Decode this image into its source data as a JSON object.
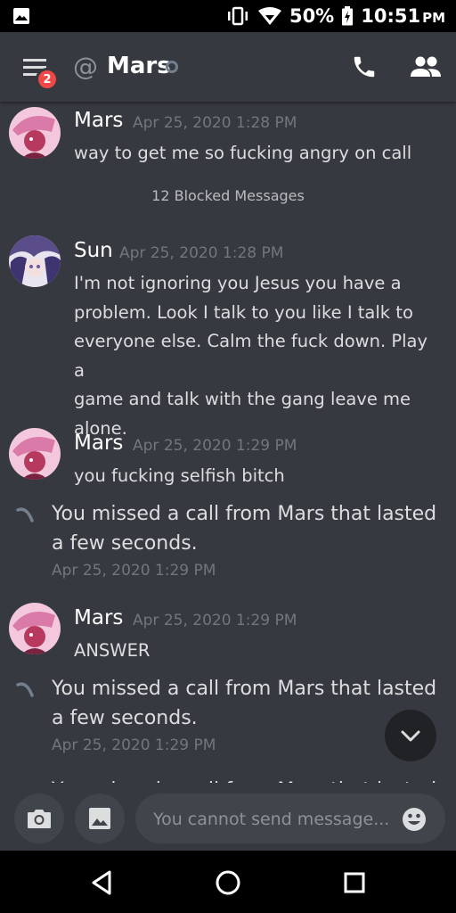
{
  "status_bar": {
    "battery": "50%",
    "time": "10:51",
    "ampm": "PM"
  },
  "header": {
    "title": "Mars",
    "at_symbol": "@",
    "notification_count": "2"
  },
  "messages": [
    {
      "author": "Mars",
      "timestamp": "Apr 25, 2020 1:28 PM",
      "text": "way to get me so fucking angry on call"
    },
    {
      "author": "Sun",
      "timestamp": "Apr 25, 2020 1:28 PM",
      "lines": [
        "I'm not ignoring you Jesus you have a",
        "problem. Look I talk to you like I talk to",
        "everyone else. Calm the fuck down. Play a",
        "game and talk with the gang leave me",
        "alone."
      ]
    },
    {
      "author": "Mars",
      "timestamp": "Apr 25, 2020 1:29 PM",
      "text": "you fucking selfish bitch"
    },
    {
      "author": "Mars",
      "timestamp": "Apr 25, 2020 1:29 PM",
      "text": "ANSWER"
    }
  ],
  "blocked_notice": "12 Blocked Messages",
  "missed_calls": [
    {
      "line1": "You missed a call from Mars that lasted",
      "line2": "a few seconds.",
      "timestamp": "Apr 25, 2020 1:29 PM"
    },
    {
      "line1": "You missed a call from Mars that lasted",
      "line2": "a few seconds.",
      "timestamp": "Apr 25, 2020 1:29 PM"
    },
    {
      "line1": "You missed a call from Mars that lasted"
    }
  ],
  "composer": {
    "placeholder": "You cannot send message..."
  },
  "colors": {
    "background": "#36393f",
    "missed_call": "#747f8d",
    "badge": "#f04747"
  }
}
